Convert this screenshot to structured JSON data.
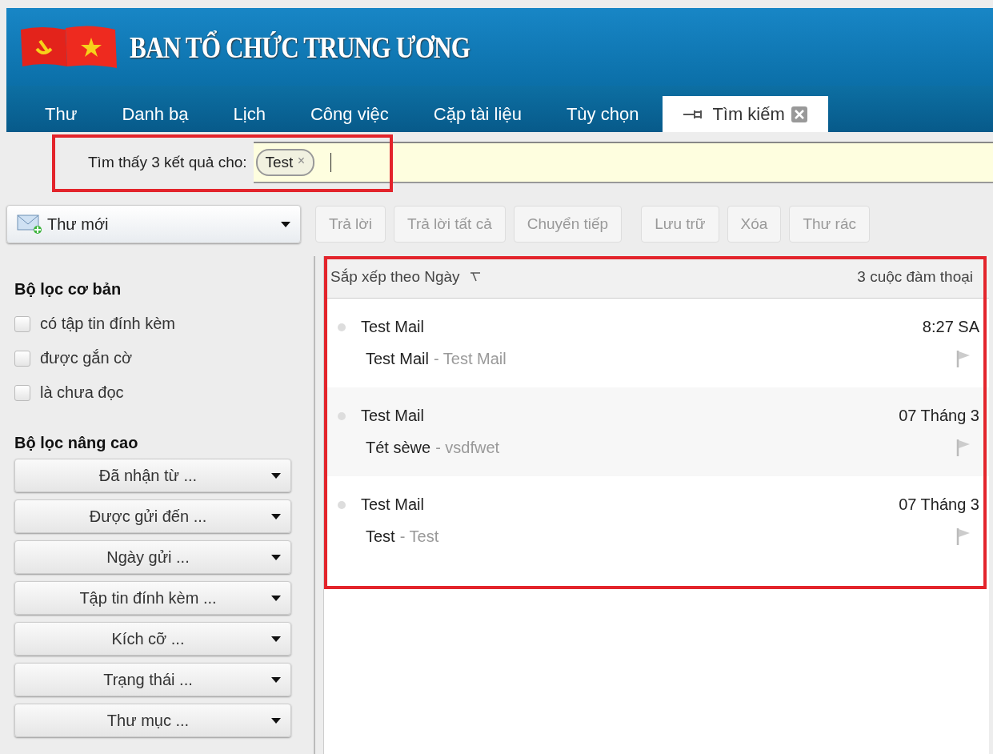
{
  "header": {
    "title": "BAN TỔ CHỨC TRUNG ƯƠNG"
  },
  "tabs": [
    {
      "label": "Thư",
      "selected": false,
      "kind": "plain"
    },
    {
      "label": "Danh bạ",
      "selected": false,
      "kind": "plain"
    },
    {
      "label": "Lịch",
      "selected": false,
      "kind": "plain"
    },
    {
      "label": "Công việc",
      "selected": false,
      "kind": "plain"
    },
    {
      "label": "Cặp tài liệu",
      "selected": false,
      "kind": "plain"
    },
    {
      "label": "Tùy chọn",
      "selected": false,
      "kind": "plain"
    },
    {
      "label": "Tìm kiếm",
      "selected": true,
      "kind": "search"
    }
  ],
  "search": {
    "label": "Tìm thấy 3 kết quả cho:",
    "terms": [
      "Test"
    ],
    "remove_symbol": "×"
  },
  "new_mail": {
    "label": "Thư mới"
  },
  "toolbar": [
    {
      "label": "Trả lời",
      "disabled": true
    },
    {
      "label": "Trả lời tất cả",
      "disabled": true
    },
    {
      "label": "Chuyển tiếp",
      "disabled": true
    },
    {
      "label": "Lưu trữ",
      "disabled": true
    },
    {
      "label": "Xóa",
      "disabled": true
    },
    {
      "label": "Thư rác",
      "disabled": true
    }
  ],
  "sidebar": {
    "basic_title": "Bộ lọc cơ bản",
    "basic_filters": [
      {
        "label": "có tập tin đính kèm",
        "checked": false
      },
      {
        "label": "được gắn cờ",
        "checked": false
      },
      {
        "label": "là chưa đọc",
        "checked": false
      }
    ],
    "advanced_title": "Bộ lọc nâng cao",
    "advanced_filters": [
      "Đã nhận từ ...",
      "Được gửi đến ...",
      "Ngày gửi ...",
      "Tập tin đính kèm ...",
      "Kích cỡ ...",
      "Trạng thái ...",
      "Thư mục ..."
    ]
  },
  "list": {
    "sort_label": "Sắp xếp theo Ngày",
    "count": "3 cuộc đàm thoại",
    "messages": [
      {
        "sender": "Test Mail",
        "time": "8:27 SA",
        "subject": "Test Mail",
        "fragment": "- Test Mail",
        "flagged": false
      },
      {
        "sender": "Test Mail",
        "time": "07 Tháng 3",
        "subject": "Tét sèwe",
        "fragment": "- vsdfwet",
        "flagged": false
      },
      {
        "sender": "Test Mail",
        "time": "07 Tháng 3",
        "subject": "Test",
        "fragment": "- Test",
        "flagged": false
      }
    ]
  }
}
